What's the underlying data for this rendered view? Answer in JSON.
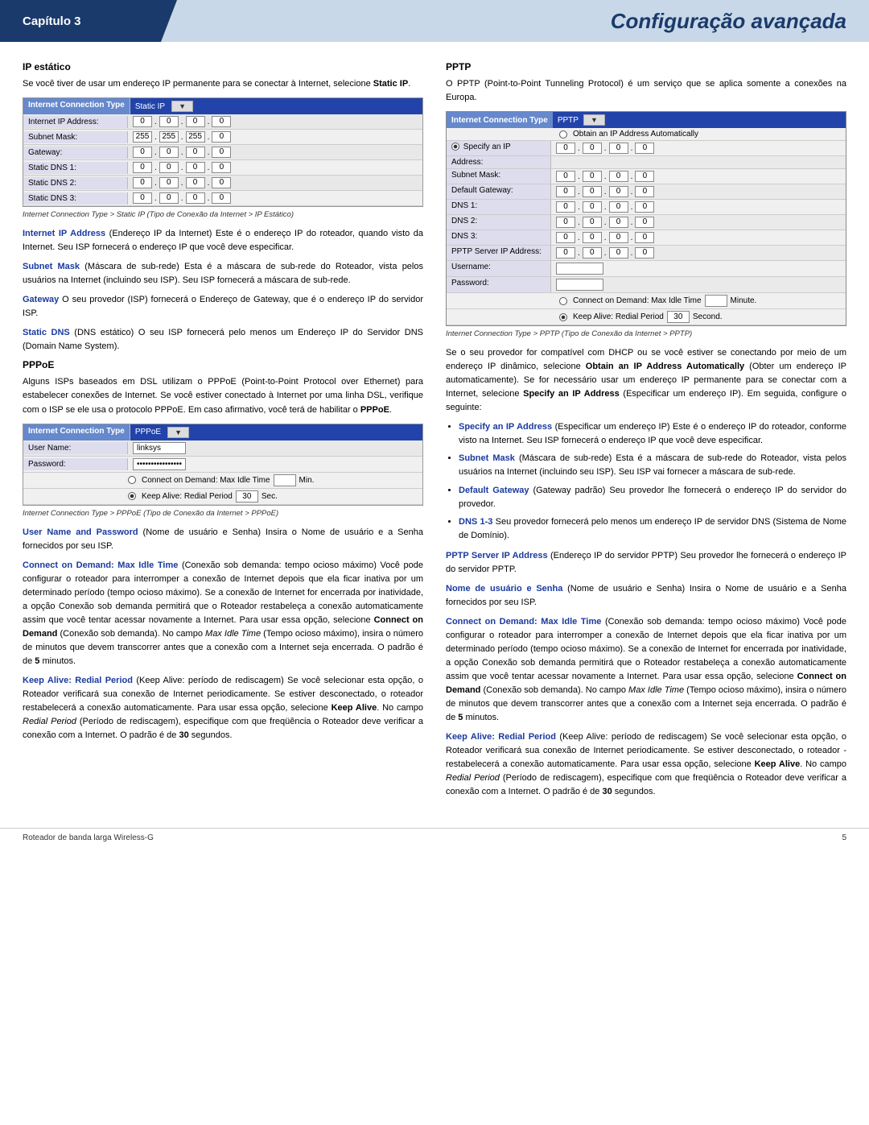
{
  "header": {
    "chapter": "Capítulo 3",
    "title": "Configuração avançada"
  },
  "left_col": {
    "ip_estatico": {
      "title": "IP estático",
      "intro": "Se você tiver de usar um endereço IP permanente para se conectar à Internet, selecione",
      "intro_bold": "Static IP",
      "table": {
        "header_label": "Internet Connection Type",
        "header_value": "Static IP",
        "rows": [
          {
            "label": "Internet IP Address:",
            "values": [
              "0",
              "0",
              "0",
              "0"
            ]
          },
          {
            "label": "Subnet Mask:",
            "values": [
              "255",
              "255",
              "255",
              "0"
            ]
          },
          {
            "label": "Gateway:",
            "values": [
              "0",
              "0",
              "0",
              "0"
            ]
          },
          {
            "label": "Static DNS 1:",
            "values": [
              "0",
              "0",
              "0",
              "0"
            ]
          },
          {
            "label": "Static DNS 2:",
            "values": [
              "0",
              "0",
              "0",
              "0"
            ]
          },
          {
            "label": "Static DNS 3:",
            "values": [
              "0",
              "0",
              "0",
              "0"
            ]
          }
        ],
        "caption": "Internet Connection Type > Static IP (Tipo de Conexão da Internet > IP Estático)"
      },
      "paragraphs": [
        {
          "term": "Internet IP Address",
          "text": " (Endereço IP da Internet) Este é o endereço IP do roteador, quando visto da Internet. Seu ISP fornecerá o endereço IP que você deve especificar."
        },
        {
          "term": "Subnet Mask",
          "text": " (Máscara de sub-rede) Esta é a máscara de sub-rede do Roteador, vista pelos usuários na Internet (incluindo seu ISP). Seu ISP fornecerá a máscara de sub-rede."
        },
        {
          "term": "Gateway",
          "text": " O seu provedor (ISP) fornecerá o Endereço de Gateway, que é o endereço IP do servidor ISP."
        },
        {
          "term": "Static DNS",
          "text": " (DNS estático) O seu ISP fornecerá pelo menos um Endereço IP do Servidor DNS (Domain Name System)."
        }
      ]
    },
    "pppoe": {
      "title": "PPPoE",
      "intro": "Alguns ISPs baseados em DSL utilizam o PPPoE (Point-to-Point Protocol over Ethernet) para estabelecer conexões de Internet. Se você estiver conectado à Internet por uma linha DSL, verifique com o ISP se ele usa o protocolo PPPoE. Em caso afirmativo, você terá de habilitar o",
      "intro_bold": "PPPoE",
      "table": {
        "header_label": "Internet Connection Type",
        "header_value": "PPPoE",
        "rows": [
          {
            "label": "User Name:",
            "value": "linksys",
            "is_text": true
          },
          {
            "label": "Password:",
            "value": "••••••••••••••••",
            "is_text": true
          }
        ],
        "radio1": "Connect on Demand: Max Idle Time",
        "radio1_input": "",
        "radio1_unit": "Min.",
        "radio2": "Keep Alive: Redial Period",
        "radio2_input": "30",
        "radio2_unit": "Sec.",
        "caption": "Internet Connection Type > PPPoE (Tipo de Conexão da Internet > PPPoE)"
      },
      "paragraphs": [
        {
          "term": "User Name and Password",
          "text": "  (Nome de usuário e Senha) Insira o Nome de usuário e a Senha fornecidos por seu ISP."
        },
        {
          "term": "Connect on Demand: Max Idle Time",
          "text": "  (Conexão sob demanda: tempo ocioso máximo) Você pode configurar o roteador para interromper a conexão de Internet depois que ela ficar inativa por um determinado período (tempo ocioso máximo). Se a conexão de Internet for encerrada por inatividade, a opção Conexão sob demanda permitirá que o Roteador restabeleça a conexão automaticamente assim que você tentar acessar novamente a Internet. Para usar essa opção, selecione",
          "text_bold": "Connect on Demand",
          "text_after": " (Conexão sob demanda). No campo",
          "text_italic": "Max Idle Time",
          "text_end": " (Tempo ocioso máximo), insira o número de minutos que devem transcorrer antes que a conexão com a Internet seja encerrada. O padrão é de",
          "text_bold2": "5",
          "text_final": "minutos."
        },
        {
          "term": "Keep Alive: Redial Period",
          "text": " (Keep Alive: período de rediscagem) Se você selecionar esta opção, o Roteador verificará sua conexão de Internet periodicamente. Se estiver desconectado, o roteador restabelecerá a conexão automaticamente. Para usar essa opção, selecione",
          "text_bold": "Keep Alive",
          "text_after": ". No campo",
          "text_italic": "Redial Period",
          "text_end": " (Período de rediscagem), especifique com que freqüência o Roteador deve verificar a conexão com a Internet. O padrão é de",
          "text_bold2": "30",
          "text_final": "segundos."
        }
      ]
    }
  },
  "right_col": {
    "pptp": {
      "title": "PPTP",
      "intro": "O PPTP (Point-to-Point Tunneling Protocol) é um serviço que se aplica somente a conexões na Europa.",
      "table": {
        "header_label": "Internet Connection Type",
        "header_value": "PPTP",
        "radio_auto": "Obtain an IP Address Automatically",
        "radio_specify": "Specify an IP Address",
        "rows_specify": [
          {
            "label": "",
            "values": [
              "0",
              "0",
              "0",
              "0"
            ]
          },
          {
            "label": "Subnet Mask:",
            "values": [
              "0",
              "0",
              "0",
              "0"
            ]
          },
          {
            "label": "Default Gateway:",
            "values": [
              "0",
              "0",
              "0",
              "0"
            ]
          },
          {
            "label": "DNS 1:",
            "values": [
              "0",
              "0",
              "0",
              "0"
            ]
          },
          {
            "label": "DNS 2:",
            "values": [
              "0",
              "0",
              "0",
              "0"
            ]
          },
          {
            "label": "DNS 3:",
            "values": [
              "0",
              "0",
              "0",
              "0"
            ]
          },
          {
            "label": "PPTP Server IP Address:",
            "values": [
              "0",
              "0",
              "0",
              "0"
            ]
          },
          {
            "label": "Username:",
            "value": "",
            "is_text": true
          },
          {
            "label": "Password:",
            "value": "",
            "is_text": true
          }
        ],
        "radio1": "Connect on Demand: Max Idle Time",
        "radio1_input": "",
        "radio1_unit": "Minute.",
        "radio2": "Keep Alive: Redial Period",
        "radio2_input": "30",
        "radio2_unit": "Second.",
        "caption": "Internet Connection Type > PPTP (Tipo de Conexão da Internet > PPTP)"
      },
      "paragraph1": "Se o seu provedor for compatível com DHCP ou se você estiver se conectando por meio de um endereço IP dinâmico, selecione",
      "paragraph1_bold": "Obtain an IP Address Automatically",
      "paragraph1_after": " (Obter um endereço IP automaticamente). Se for necessário usar um endereço IP permanente para se conectar com a Internet, selecione",
      "paragraph1_bold2": "Specify an IP Address",
      "paragraph1_after2": " (Especificar um endereço IP). Em seguida, configure o seguinte:",
      "bullets": [
        {
          "term": "Specify an IP Address",
          "text": "  (Especificar um endereço IP) Este é o endereço IP do roteador, conforme visto na Internet. Seu ISP fornecerá o endereço IP que você deve especificar."
        },
        {
          "term": "Subnet Mask",
          "text": " (Máscara de sub-rede) Esta é a máscara de sub-rede do Roteador, vista pelos usuários na Internet (incluindo seu ISP). Seu ISP vai fornecer a máscara de sub-rede."
        },
        {
          "term": "Default Gateway",
          "text": " (Gateway padrão) Seu provedor lhe fornecerá o endereço IP do servidor do provedor."
        },
        {
          "term": "DNS 1-3",
          "text": " Seu provedor fornecerá pelo menos um endereço IP de servidor DNS (Sistema de Nome de Domínio)."
        }
      ],
      "paragraphs": [
        {
          "term": "PPTP Server IP Address",
          "text": "  (Endereço IP do servidor PPTP) Seu provedor lhe fornecerá o endereço IP do servidor PPTP."
        },
        {
          "term": "Nome de usuário e Senha",
          "text": "  (Nome de usuário e Senha) Insira o Nome de usuário e a Senha fornecidos por seu ISP."
        },
        {
          "term": "Connect on Demand: Max Idle Time",
          "text": "  (Conexão sob demanda: tempo ocioso máximo) Você pode configurar o roteador para interromper a conexão de Internet depois que ela ficar inativa por um determinado período (tempo ocioso máximo). Se a conexão de Internet for encerrada por inatividade, a opção Conexão sob demanda permitirá que o Roteador restabeleça a conexão automaticamente assim que você tentar acessar novamente a Internet. Para usar essa opção, selecione",
          "text_bold": "Connect on Demand",
          "text_after": " (Conexão sob demanda). No campo",
          "text_italic": "Max Idle Time",
          "text_end": " (Tempo ocioso máximo), insira o número de minutos que devem transcorrer antes que a conexão com a Internet seja encerrada. O padrão é de",
          "text_bold2": "5",
          "text_final": "minutos."
        },
        {
          "term": "Keep Alive: Redial Period",
          "text": " (Keep Alive: período de rediscagem) Se você selecionar esta opção, o Roteador verificará sua conexão de Internet periodicamente. Se estiver desconectado, o roteador -restabelecerá a conexão automaticamente. Para usar essa opção, selecione",
          "text_bold": "Keep Alive",
          "text_after": ". No campo",
          "text_italic": "Redial Period",
          "text_end": " (Período de rediscagem), especifique com que freqüência o Roteador deve verificar a conexão com a Internet. O padrão é de",
          "text_bold2": "30",
          "text_final": "segundos."
        }
      ]
    }
  },
  "footer": {
    "left": "Roteador de banda larga Wireless-G",
    "right": "5"
  }
}
